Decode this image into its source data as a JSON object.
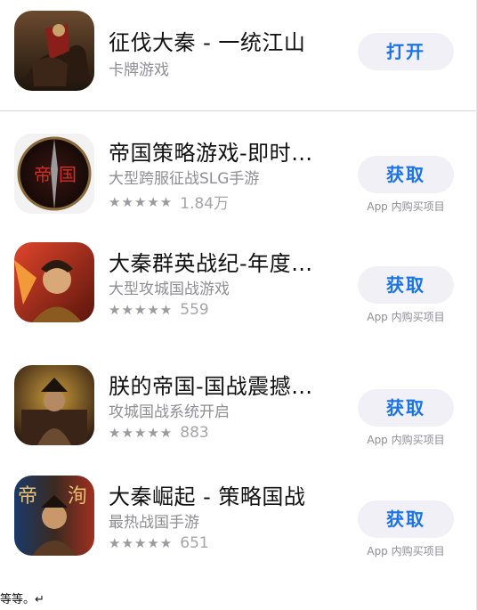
{
  "apps": [
    {
      "title": "征伐大秦 - 一统江山",
      "subtitle": "卡牌游戏",
      "button": "打开"
    },
    {
      "title": "帝国策略游戏-即时…",
      "subtitle": "大型跨服征战SLG手游",
      "stars": "★★★★★",
      "rating_count": "1.84万",
      "button": "获取",
      "iap": "App 内购买项目",
      "icon_text": "帝国"
    },
    {
      "title": "大秦群英战纪-年度…",
      "subtitle": "大型攻城国战游戏",
      "stars": "★★★★★",
      "rating_count": "559",
      "button": "获取",
      "iap": "App 内购买项目"
    },
    {
      "title": "朕的帝国-国战震撼…",
      "subtitle": "攻城国战系统开启",
      "stars": "★★★★★",
      "rating_count": "883",
      "button": "获取",
      "iap": "App 内购买项目"
    },
    {
      "title": "大秦崛起 - 策略国战",
      "subtitle": "最热战国手游",
      "stars": "★★★★★",
      "rating_count": "651",
      "button": "获取",
      "iap": "App 内购买项目",
      "icon_text": "帝洵"
    }
  ],
  "footnote": "等等。↵",
  "colors": {
    "button_text": "#1a73e8",
    "button_bg": "#f0f0f6"
  }
}
